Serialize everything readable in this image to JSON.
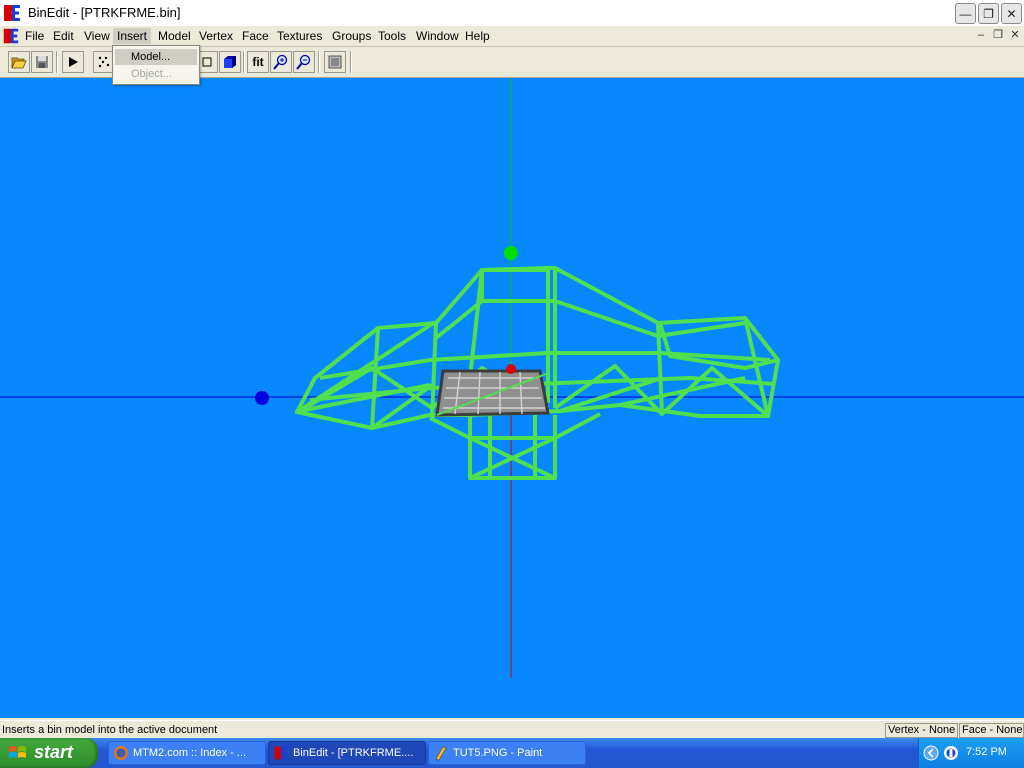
{
  "window": {
    "title": "BinEdit - [PTRKFRME.bin]"
  },
  "menu": {
    "items": [
      "File",
      "Edit",
      "View",
      "Insert",
      "Model",
      "Vertex",
      "Face",
      "Textures",
      "Groups",
      "Tools",
      "Window",
      "Help"
    ],
    "open_menu": "Insert",
    "insert_items": [
      {
        "label": "Model...",
        "enabled": true,
        "highlighted": true
      },
      {
        "label": "Object...",
        "enabled": false
      }
    ]
  },
  "toolbar": {
    "fit_label": "fit"
  },
  "status": {
    "message": "Inserts a bin model into the active document",
    "vertex": "Vertex - None",
    "face": "Face - None"
  },
  "taskbar": {
    "start_label": "start",
    "items": [
      {
        "label": "MTM2.com :: Index - ...",
        "active": false
      },
      {
        "label": "BinEdit - [PTRKFRME....",
        "active": true
      },
      {
        "label": "TUT5.PNG - Paint",
        "active": false
      }
    ],
    "clock": "7:52 PM"
  },
  "colors": {
    "viewport_bg": "#0788ff",
    "wireframe": "#4fe04f",
    "axis_x": "#0000c8",
    "axis_y": "#00c800",
    "axis_z": "#c80000"
  }
}
